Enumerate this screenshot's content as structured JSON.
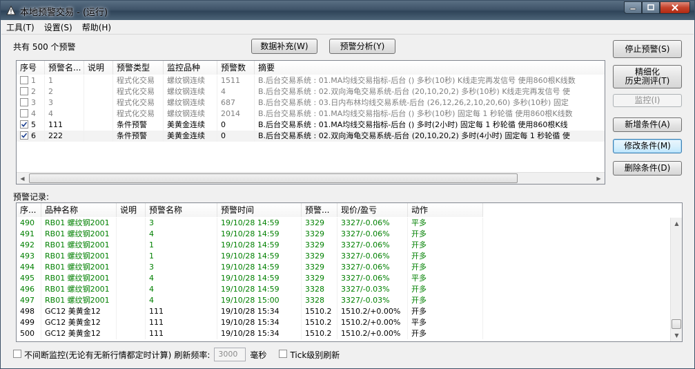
{
  "window": {
    "title": "本地预警交易 - (运行)",
    "icon": "alert-triangle-icon"
  },
  "menu": {
    "items": [
      "工具(T)",
      "设置(S)",
      "帮助(H)"
    ]
  },
  "top": {
    "count_label": "共有 500 个预警",
    "supplement_button": "数据补充(W)",
    "analysis_button": "预警分析(Y)"
  },
  "side_buttons": {
    "stop": "停止预警(S)",
    "backtest_line1": "精细化",
    "backtest_line2": "历史测评(T)",
    "monitor": "监控(I)",
    "add": "新增条件(A)",
    "modify": "修改条件(M)",
    "delete": "删除条件(D)"
  },
  "conditions": {
    "headers": [
      "序号",
      "预警名...",
      "说明",
      "预警类型",
      "监控品种",
      "预警数",
      "摘要"
    ],
    "rows": [
      {
        "checked": false,
        "no": "1",
        "name": "1",
        "desc": "",
        "type": "程式化交易",
        "symbol": "螺纹钢连续",
        "count": "1511",
        "summary": "B.后台交易系统 : 01.MA均线交易指标-后台 () 多秒(10秒) K线走完再发信号 使用860根K线数"
      },
      {
        "checked": false,
        "no": "2",
        "name": "2",
        "desc": "",
        "type": "程式化交易",
        "symbol": "螺纹钢连续",
        "count": "4",
        "summary": "B.后台交易系统 : 02.双向海龟交易系统-后台 (20,10,20,2) 多秒(10秒) K线走完再发信号 使"
      },
      {
        "checked": false,
        "no": "3",
        "name": "3",
        "desc": "",
        "type": "程式化交易",
        "symbol": "螺纹钢连续",
        "count": "687",
        "summary": "B.后台交易系统 : 03.日内布林均线交易系统-后台 (26,12,26,2,10,20,60) 多秒(10秒) 固定"
      },
      {
        "checked": false,
        "no": "4",
        "name": "4",
        "desc": "",
        "type": "程式化交易",
        "symbol": "螺纹钢连续",
        "count": "2014",
        "summary": "B.后台交易系统 : 01.MA均线交易指标-后台 () 多秒(10秒) 固定每 1 秒轮循 使用860根K线数"
      },
      {
        "checked": true,
        "no": "5",
        "name": "111",
        "desc": "",
        "type": "条件预警",
        "symbol": "美黄金连续",
        "count": "0",
        "summary": "B.后台交易系统 : 01.MA均线交易指标-后台 () 多时(2小时) 固定每 1 秒轮循 使用860根K线"
      },
      {
        "checked": true,
        "no": "6",
        "name": "222",
        "desc": "",
        "type": "条件预警",
        "symbol": "美黄金连续",
        "count": "0",
        "summary": "B.后台交易系统 : 02.双向海龟交易系统-后台 (20,10,20,2) 多时(4小时) 固定每 1 秒轮循 使"
      }
    ]
  },
  "records": {
    "label": "预警记录:",
    "headers": [
      "序...",
      "品种名称",
      "说明",
      "预警名称",
      "预警时间",
      "预警...",
      "现价/盈亏",
      "动作"
    ],
    "rows": [
      {
        "no": "490",
        "product": "RB01 螺纹钢2001",
        "desc": "",
        "alert": "3",
        "time": "19/10/28 14:59",
        "price": "3329",
        "pnl": "3327/-0.06%",
        "action": "平多",
        "color": "green"
      },
      {
        "no": "491",
        "product": "RB01 螺纹钢2001",
        "desc": "",
        "alert": "4",
        "time": "19/10/28 14:59",
        "price": "3329",
        "pnl": "3327/-0.06%",
        "action": "开多",
        "color": "green"
      },
      {
        "no": "492",
        "product": "RB01 螺纹钢2001",
        "desc": "",
        "alert": "1",
        "time": "19/10/28 14:59",
        "price": "3329",
        "pnl": "3327/-0.06%",
        "action": "开多",
        "color": "green"
      },
      {
        "no": "493",
        "product": "RB01 螺纹钢2001",
        "desc": "",
        "alert": "1",
        "time": "19/10/28 14:59",
        "price": "3329",
        "pnl": "3327/-0.06%",
        "action": "开多",
        "color": "green"
      },
      {
        "no": "494",
        "product": "RB01 螺纹钢2001",
        "desc": "",
        "alert": "3",
        "time": "19/10/28 14:59",
        "price": "3329",
        "pnl": "3327/-0.06%",
        "action": "开多",
        "color": "green"
      },
      {
        "no": "495",
        "product": "RB01 螺纹钢2001",
        "desc": "",
        "alert": "4",
        "time": "19/10/28 14:59",
        "price": "3329",
        "pnl": "3327/-0.06%",
        "action": "平多",
        "color": "green"
      },
      {
        "no": "496",
        "product": "RB01 螺纹钢2001",
        "desc": "",
        "alert": "4",
        "time": "19/10/28 14:59",
        "price": "3328",
        "pnl": "3327/-0.03%",
        "action": "开多",
        "color": "green"
      },
      {
        "no": "497",
        "product": "RB01 螺纹钢2001",
        "desc": "",
        "alert": "4",
        "time": "19/10/28 15:00",
        "price": "3328",
        "pnl": "3327/-0.03%",
        "action": "开多",
        "color": "green"
      },
      {
        "no": "498",
        "product": "GC12 美黄金12",
        "desc": "",
        "alert": "111",
        "time": "19/10/28 15:34",
        "price": "1510.2",
        "pnl": "1510.2/+0.00%",
        "action": "开多",
        "color": "black"
      },
      {
        "no": "499",
        "product": "GC12 美黄金12",
        "desc": "",
        "alert": "111",
        "time": "19/10/28 15:34",
        "price": "1510.2",
        "pnl": "1510.2/+0.00%",
        "action": "平多",
        "color": "black"
      },
      {
        "no": "500",
        "product": "GC12 美黄金12",
        "desc": "",
        "alert": "111",
        "time": "19/10/28 15:34",
        "price": "1510.2",
        "pnl": "1510.2/+0.00%",
        "action": "开多",
        "color": "black"
      }
    ]
  },
  "bottom": {
    "continuous_label": "不间断监控(无论有无新行情都定时计算)",
    "refresh_label": "刷新频率:",
    "refresh_value": "3000",
    "unit": "毫秒",
    "tick_label": "Tick级别刷新"
  },
  "colors": {
    "green": "#008000",
    "gray": "#808080",
    "black": "#000000"
  }
}
